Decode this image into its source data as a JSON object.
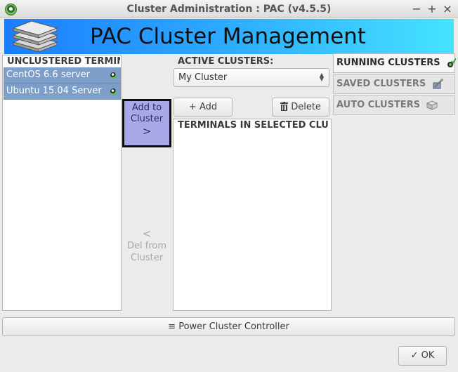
{
  "window": {
    "title": "Cluster Administration : PAC (v4.5.5)",
    "min_glyph": "−",
    "max_glyph": "+",
    "close_glyph": "×"
  },
  "banner": {
    "title": "PAC Cluster Management"
  },
  "unclustered": {
    "header": "UNCLUSTERED TERMINALS",
    "items": [
      {
        "label": "CentOS 6.6 server"
      },
      {
        "label": "Ubuntu 15.04 Server"
      }
    ]
  },
  "actions": {
    "add_line1": "Add to",
    "add_line2": "Cluster",
    "add_arrow": ">",
    "del_arrow": "<",
    "del_line1": "Del from",
    "del_line2": "Cluster"
  },
  "active_clusters": {
    "header": "ACTIVE CLUSTERS:",
    "selected": "My Cluster",
    "add_label": "Add",
    "add_glyph": "+",
    "delete_label": "Delete",
    "terminals_header": "TERMINALS IN SELECTED CLUSTER"
  },
  "tabs": [
    {
      "label": "RUNNING CLUSTERS",
      "icon": "running-check-icon",
      "active": true
    },
    {
      "label": "SAVED CLUSTERS",
      "icon": "saved-wrench-icon",
      "active": false
    },
    {
      "label": "AUTO CLUSTERS",
      "icon": "auto-box-icon",
      "active": false
    }
  ],
  "footer": {
    "power_label": "Power Cluster Controller",
    "power_glyph": "≡",
    "ok_label": "OK",
    "ok_glyph": "✓"
  },
  "colors": {
    "banner_start": "#1b7dff",
    "banner_end": "#45e3ff",
    "selection": "#7c9ec8",
    "add_button_bg": "#a9a9e9"
  }
}
